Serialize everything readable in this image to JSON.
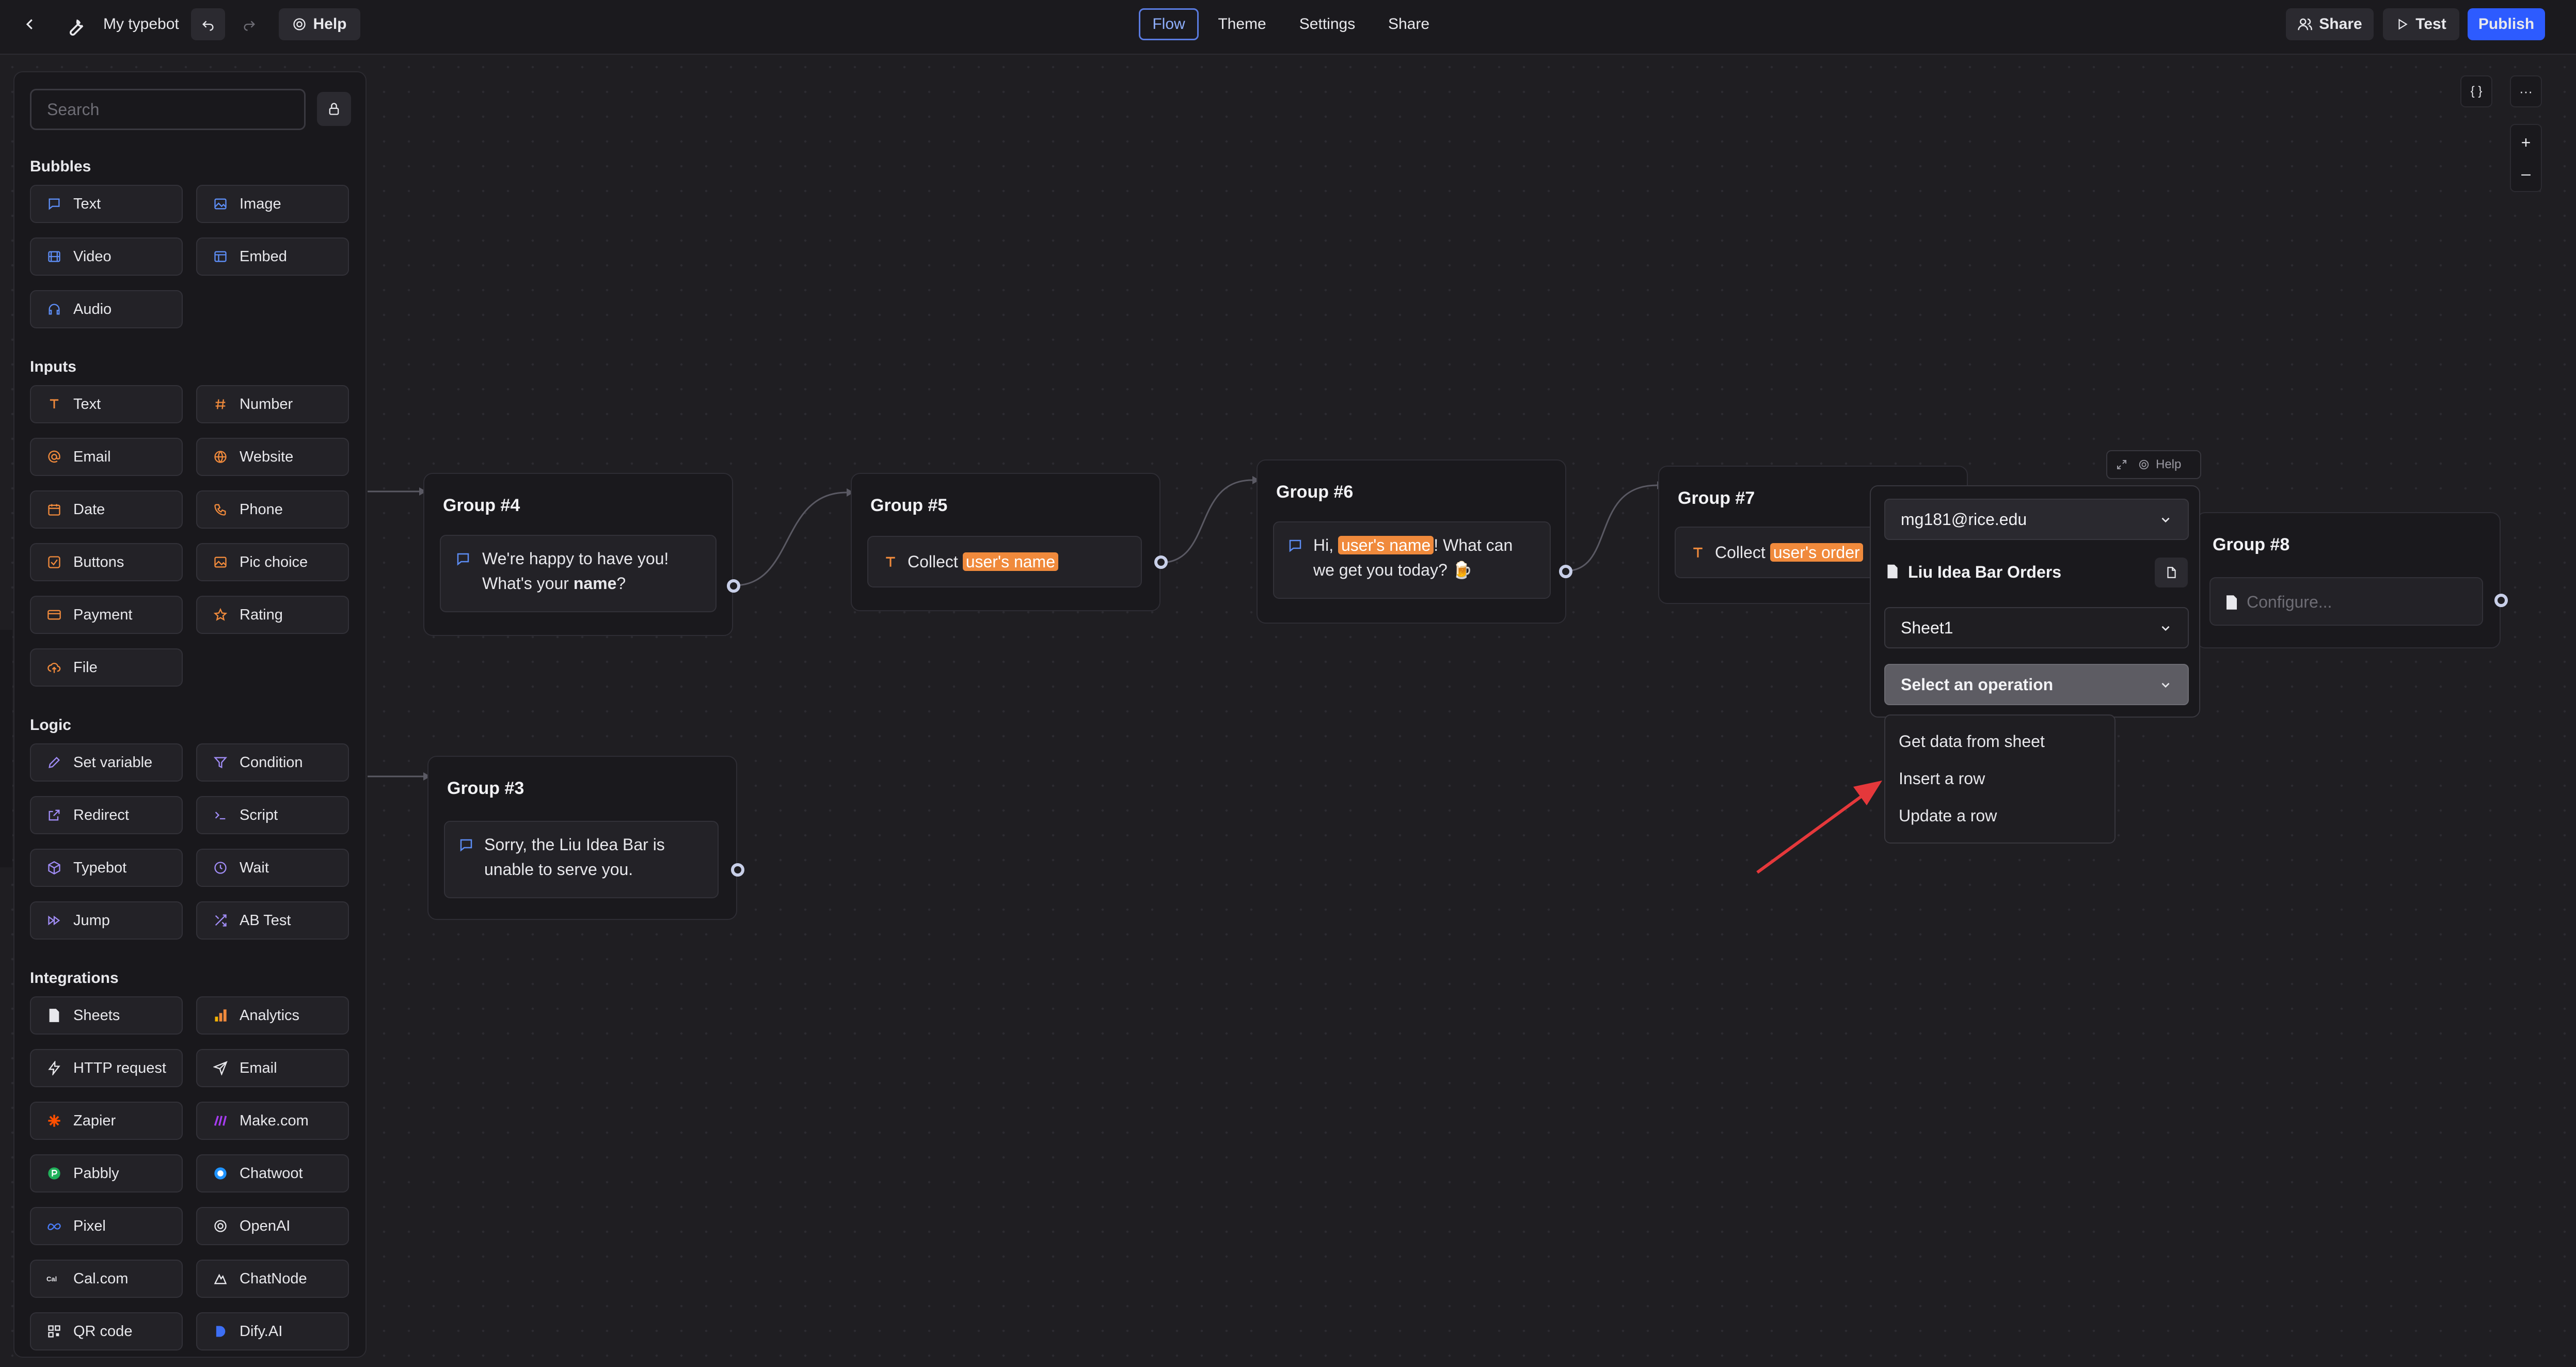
{
  "topbar": {
    "bot_name": "My typebot",
    "help": "Help",
    "tabs": [
      "Flow",
      "Theme",
      "Settings",
      "Share"
    ],
    "share": "Share",
    "test": "Test",
    "publish": "Publish"
  },
  "canvas_controls": {
    "variables": "{ }",
    "more": "···",
    "zoom_in": "+",
    "zoom_out": "–"
  },
  "sidebar": {
    "search_placeholder": "Search",
    "sections": {
      "bubbles": "Bubbles",
      "inputs": "Inputs",
      "logic": "Logic",
      "integrations": "Integrations"
    },
    "bubbles": [
      "Text",
      "Image",
      "Video",
      "Embed",
      "Audio"
    ],
    "inputs": [
      "Text",
      "Number",
      "Email",
      "Website",
      "Date",
      "Phone",
      "Buttons",
      "Pic choice",
      "Payment",
      "Rating",
      "File"
    ],
    "logic": [
      "Set variable",
      "Condition",
      "Redirect",
      "Script",
      "Typebot",
      "Wait",
      "Jump",
      "AB Test"
    ],
    "integrations": [
      "Sheets",
      "Analytics",
      "HTTP request",
      "Email",
      "Zapier",
      "Make.com",
      "Pabbly",
      "Chatwoot",
      "Pixel",
      "OpenAI",
      "Cal.com",
      "ChatNode",
      "QR code",
      "Dify.AI"
    ]
  },
  "groups": {
    "g4": {
      "title": "Group #4",
      "line1": "We're happy to have you!",
      "line2_pre": "What's your ",
      "line2_bold": "name",
      "line2_post": "?"
    },
    "g5": {
      "title": "Group #5",
      "prefix": "Collect",
      "var": "user's name"
    },
    "g6": {
      "title": "Group #6",
      "pre": "Hi, ",
      "var": "user's name",
      "post": "! What can",
      "line2": "we get you today? 🍺"
    },
    "g7": {
      "title": "Group #7",
      "prefix": "Collect",
      "var": "user's order"
    },
    "g8": {
      "title": "Group #8",
      "placeholder": "Configure..."
    },
    "g3": {
      "title": "Group #3",
      "line1": "Sorry, the Liu Idea Bar is",
      "line2": "unable to serve you."
    }
  },
  "sheets_panel": {
    "help": "Help",
    "account": "mg181@rice.edu",
    "spreadsheet": "Liu Idea Bar Orders",
    "sheet": "Sheet1",
    "operation_placeholder": "Select an operation",
    "operations": [
      "Get data from sheet",
      "Insert a row",
      "Update a row"
    ]
  },
  "colors": {
    "accent": "#2d5bff",
    "variable_tag": "#f08a3c",
    "annotation_arrow": "#e5383b"
  }
}
